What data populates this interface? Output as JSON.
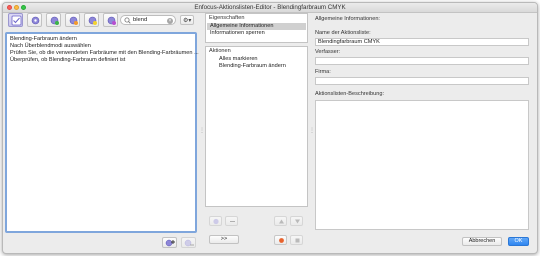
{
  "window": {
    "title": "Enfocus-Aktionslisten-Editor - Blendingfarbraum CMYK"
  },
  "toolbar": {
    "search_value": "blend",
    "search_clear": "×",
    "gear_label": "⚙▾",
    "buttons": [
      "checklist-icon",
      "action-gear-icon",
      "action-gear-green-icon",
      "action-gear-orange-icon",
      "action-gear-yellow-icon",
      "action-gear-purple-icon"
    ]
  },
  "action_list": {
    "rows": [
      "Blending-Farbraum ändern",
      "Nach Überblendmodi auswählen",
      "Prüfen Sie, ob die verwendeten Farbräume mit den Blending-Farbräumen ...",
      "Überprüfen, ob Blending-Farbraum definiert ist"
    ]
  },
  "properties": {
    "header": "Eigenschaften",
    "items": [
      "Allgemeine Informationen",
      "Informationen sperren"
    ],
    "selected_index": 0
  },
  "actions": {
    "header": "Aktionen",
    "items": [
      "Alles markieren",
      "Blending-Farbraum ändern"
    ],
    "expand_label": ">>"
  },
  "general_info": {
    "section_label": "Allgemeine Informationen:",
    "name_label": "Name der Aktionsliste:",
    "name_value": "Blendingfarbraum CMYK",
    "author_label": "Verfasser:",
    "author_value": "",
    "company_label": "Firma:",
    "company_value": "",
    "description_label": "Aktionslisten-Beschreibung:",
    "description_value": ""
  },
  "footer": {
    "cancel_label": "Abbrechen",
    "ok_label": "OK"
  },
  "colors": {
    "accent": "#2f86f0",
    "selection": "#d0d0d0",
    "focus_ring": "#7fa6dc"
  }
}
